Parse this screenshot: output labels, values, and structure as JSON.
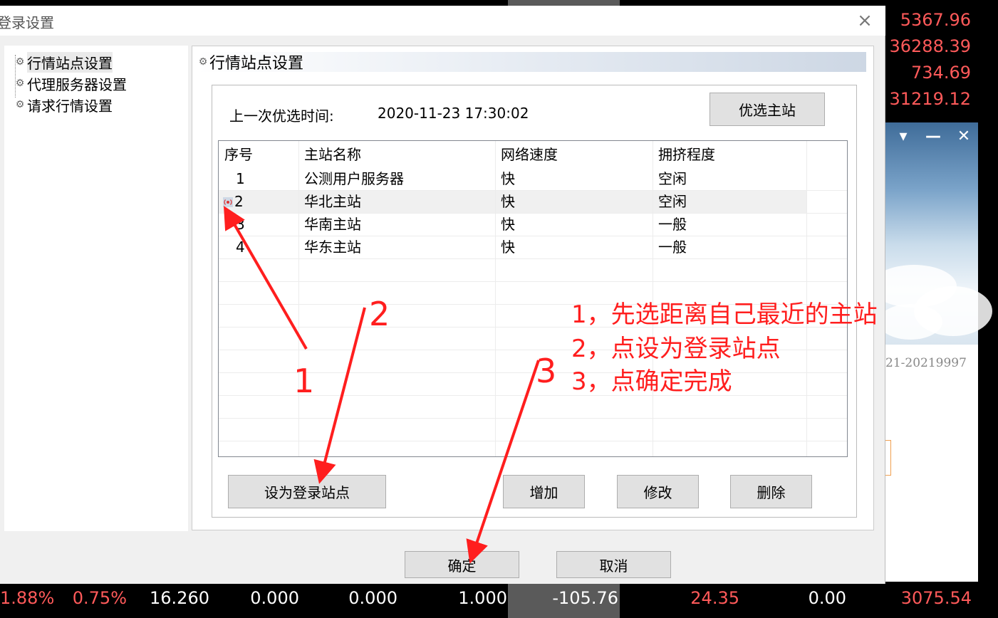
{
  "terminal": {
    "right_values": [
      "5367.96",
      "36288.39",
      "734.69",
      "31219.12"
    ],
    "bottom_row": [
      "1.88%",
      "0.75%",
      "16.260",
      "0.000",
      "0.000",
      "1.000",
      "-105.76",
      "24.35",
      "0.00",
      "3075.54"
    ],
    "colors": {
      "up": "#ff5a5a",
      "neutral": "#ffffff"
    }
  },
  "popup": {
    "text": "21-20219997",
    "controls": {
      "menu": "▾",
      "minimize": "—",
      "close": "✕"
    }
  },
  "dialog": {
    "title": "登录设置",
    "close_glyph": "×",
    "tree": [
      {
        "label": "行情站点设置",
        "icon": "gear-icon"
      },
      {
        "label": "代理服务器设置",
        "icon": "gear-icon"
      },
      {
        "label": "请求行情设置",
        "icon": "gear-icon"
      }
    ],
    "panel_title": "行情站点设置",
    "last_optimize_label": "上一次优选时间:",
    "last_optimize_value": "2020-11-23 17:30:02",
    "optimize_button": "优选主站",
    "columns": [
      "序号",
      "主站名称",
      "网络速度",
      "拥挤程度"
    ],
    "rows": [
      {
        "no": "1",
        "name": "公测用户服务器",
        "speed": "快",
        "load": "空闲",
        "selected": false
      },
      {
        "no": "2",
        "name": "华北主站",
        "speed": "快",
        "load": "空闲",
        "selected": true
      },
      {
        "no": "3",
        "name": "华南主站",
        "speed": "快",
        "load": "一般",
        "selected": false
      },
      {
        "no": "4",
        "name": "华东主站",
        "speed": "快",
        "load": "一般",
        "selected": false
      }
    ],
    "set_login_button": "设为登录站点",
    "add_button": "增加",
    "edit_button": "修改",
    "delete_button": "删除",
    "ok_button": "确定",
    "cancel_button": "取消"
  },
  "annotations": {
    "numbers": [
      "1",
      "2",
      "3"
    ],
    "lines": [
      "1，先选距离自己最近的主站",
      "2，点设为登录站点",
      "3，点确定完成"
    ],
    "color": "#ff1e1e"
  }
}
